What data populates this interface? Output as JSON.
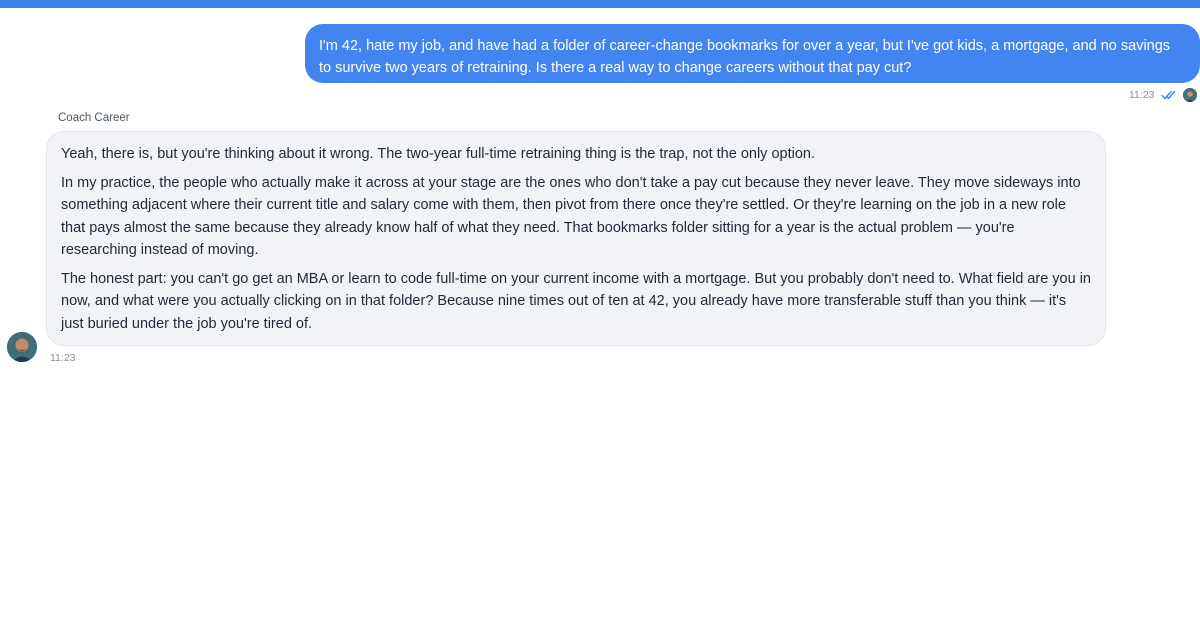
{
  "theme": {
    "accent": "#3b82e6",
    "user_bubble": "#4285f0",
    "bot_bubble": "#f1f3f6"
  },
  "conversation": {
    "user_message": {
      "text": "I'm 42, hate my job, and have had a folder of career-change bookmarks for over a year, but I've got kids, a mortgage, and no savings to survive two years of retraining. Is there a real way to change careers without that pay cut?",
      "time": "11:23",
      "status_icon": "double-check-icon",
      "avatar_icon": "user-avatar-icon"
    },
    "bot_message": {
      "sender": "Coach Career",
      "paragraphs": [
        "Yeah, there is, but you're thinking about it wrong. The two-year full-time retraining thing is the trap, not the only option.",
        "In my practice, the people who actually make it across at your stage are the ones who don't take a pay cut because they never leave. They move sideways into something adjacent where their current title and salary come with them, then pivot from there once they're settled. Or they're learning on the job in a new role that pays almost the same because they already know half of what they need. That bookmarks folder sitting for a year is the actual problem — you're researching instead of moving.",
        "The honest part: you can't go get an MBA or learn to code full-time on your current income with a mortgage. But you probably don't need to. What field are you in now, and what were you actually clicking on in that folder? Because nine times out of ten at 42, you already have more transferable stuff than you think — it's just buried under the job you're tired of."
      ],
      "time": "11:23",
      "avatar_icon": "coach-avatar-icon"
    }
  }
}
